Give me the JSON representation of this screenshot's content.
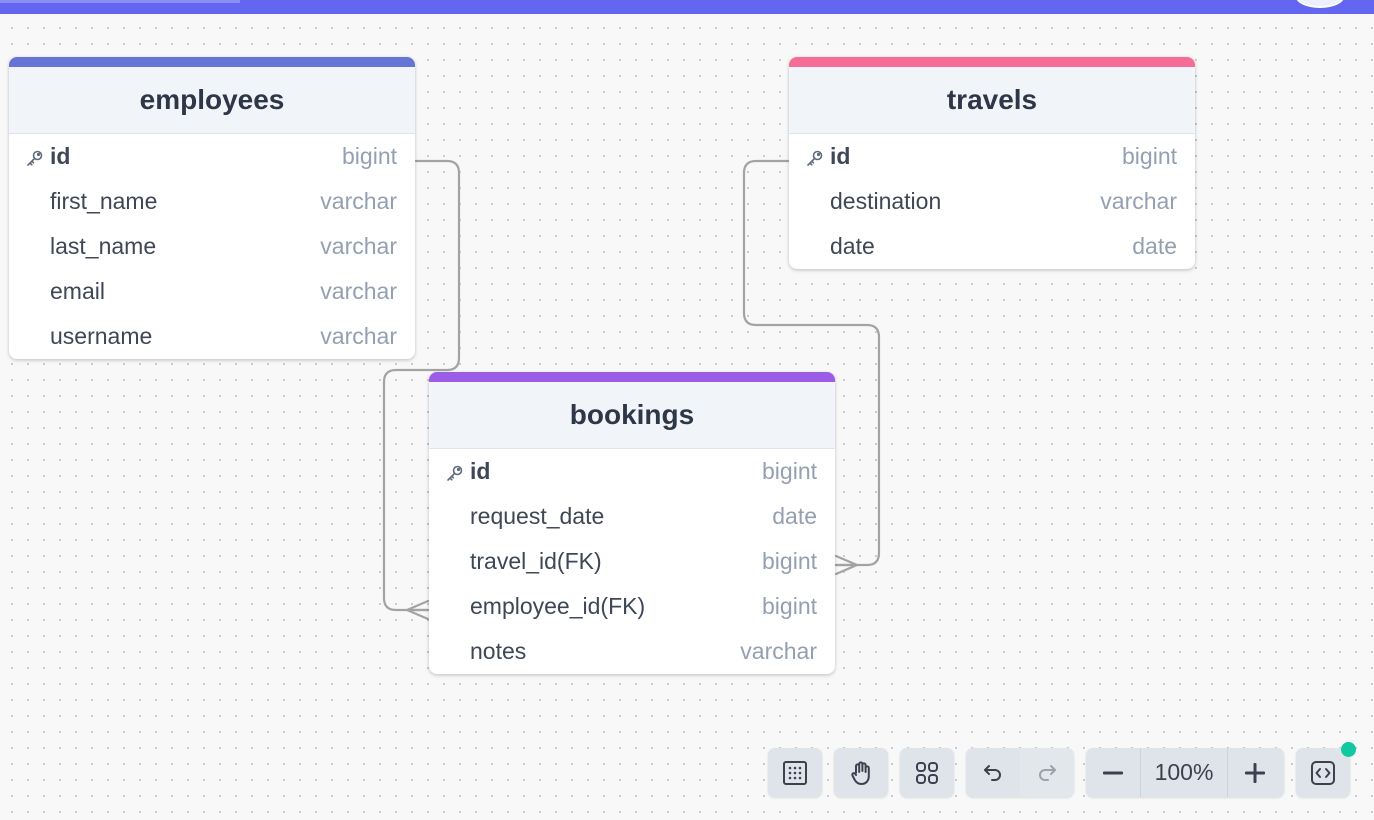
{
  "tables": {
    "employees": {
      "name": "employees",
      "accent": "#6674d6",
      "fields": [
        {
          "name": "id",
          "type": "bigint",
          "pk": true
        },
        {
          "name": "first_name",
          "type": "varchar"
        },
        {
          "name": "last_name",
          "type": "varchar"
        },
        {
          "name": "email",
          "type": "varchar"
        },
        {
          "name": "username",
          "type": "varchar"
        }
      ]
    },
    "travels": {
      "name": "travels",
      "accent": "#f56d96",
      "fields": [
        {
          "name": "id",
          "type": "bigint",
          "pk": true
        },
        {
          "name": "destination",
          "type": "varchar"
        },
        {
          "name": "date",
          "type": "date"
        }
      ]
    },
    "bookings": {
      "name": "bookings",
      "accent": "#9b5de5",
      "fields": [
        {
          "name": "id",
          "type": "bigint",
          "pk": true
        },
        {
          "name": "request_date",
          "type": "date"
        },
        {
          "name": "travel_id(FK)",
          "type": "bigint"
        },
        {
          "name": "employee_id(FK)",
          "type": "bigint"
        },
        {
          "name": "notes",
          "type": "varchar"
        }
      ]
    }
  },
  "relationships": [
    {
      "from": "employees.id",
      "to": "bookings.employee_id(FK)",
      "cardinality": "one-to-many"
    },
    {
      "from": "travels.id",
      "to": "bookings.travel_id(FK)",
      "cardinality": "one-to-many"
    }
  ],
  "toolbar": {
    "zoom_level": "100%",
    "icons": [
      "grid-icon",
      "hand-icon",
      "layout-icon",
      "undo-icon",
      "redo-icon",
      "zoom-out-icon",
      "zoom-in-icon",
      "code-icon"
    ]
  },
  "colors": {
    "top_bar": "#6366f1",
    "status_dot": "#10c9a0"
  }
}
